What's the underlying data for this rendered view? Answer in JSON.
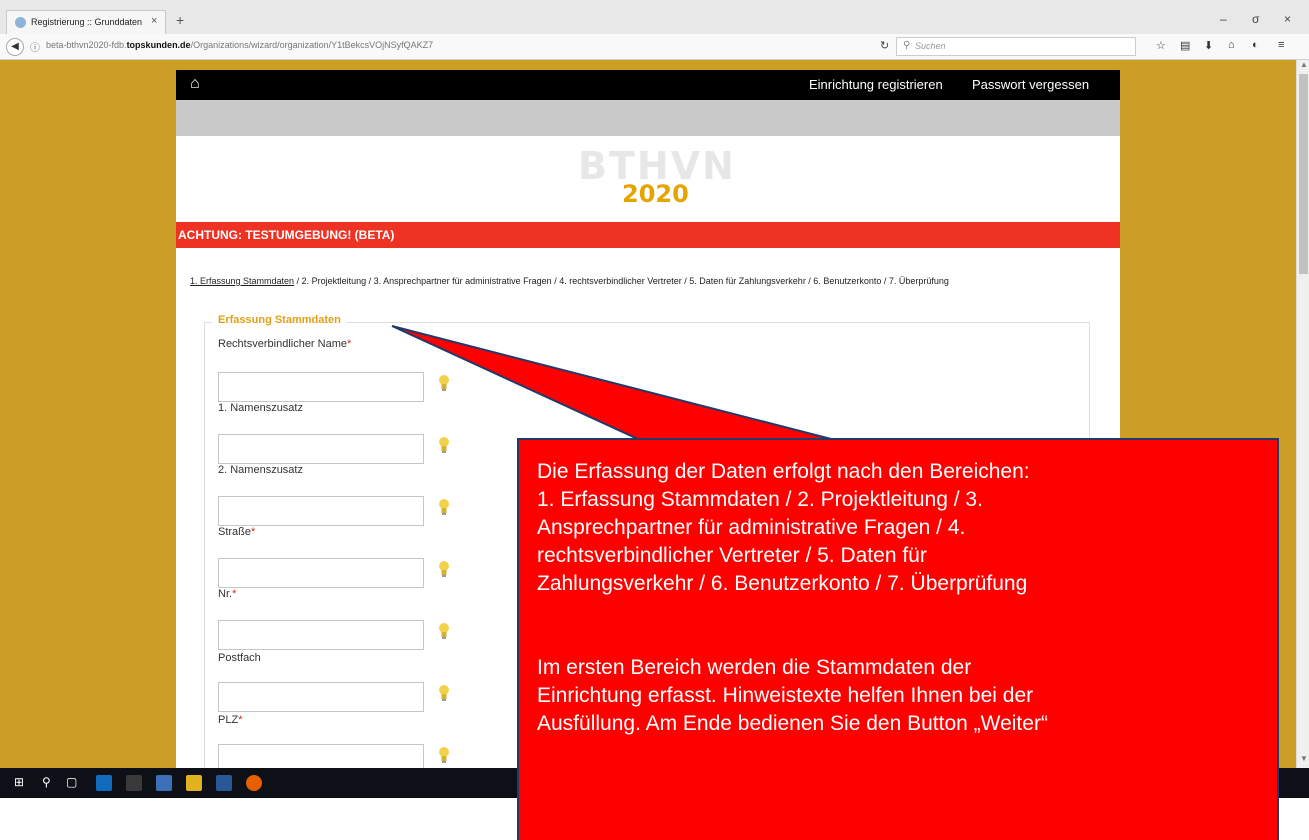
{
  "browser": {
    "tab_title": "Registrierung :: Grunddaten",
    "tab_close": "×",
    "new_tab": "+",
    "url_prefix": "beta-bthvn2020-fdb.",
    "url_domain": "topskunden.de",
    "url_path": "/Organizations/wizard/organization/Y1tBekcsVOjNSyfQAKZ7",
    "search_placeholder": "Suchen",
    "win_minimize": "–",
    "win_restore": "σ",
    "win_close": "×"
  },
  "nav": {
    "register": "Einrichtung registrieren",
    "password": "Passwort vergessen"
  },
  "logo": {
    "line1": "BTHVN",
    "line2": "2020"
  },
  "warning": "ACHTUNG: TESTUMGEBUNG! (BETA)",
  "steps": {
    "active": "1. Erfassung Stammdaten",
    "rest": " / 2. Projektleitung / 3. Ansprechpartner für administrative Fragen / 4. rechtsverbindlicher Vertreter / 5. Daten für Zahlungsverkehr / 6. Benutzerkonto / 7. Überprüfung"
  },
  "form": {
    "legend": "Erfassung Stammdaten",
    "fields": [
      {
        "label": "Rechtsverbindlicher Name",
        "required": "*"
      },
      {
        "label": "1. Namenszusatz",
        "required": ""
      },
      {
        "label": "2. Namenszusatz",
        "required": ""
      },
      {
        "label": "Straße",
        "required": "*"
      },
      {
        "label": "Nr.",
        "required": "*"
      },
      {
        "label": "Postfach",
        "required": ""
      },
      {
        "label": "PLZ",
        "required": "*"
      }
    ]
  },
  "callout": {
    "lines": [
      "Die Erfassung der Daten erfolgt nach den Bereichen:",
      "1. Erfassung Stammdaten / 2. Projektleitung / 3.",
      "Ansprechpartner für administrative Fragen / 4.",
      "rechtsverbindlicher Vertreter / 5. Daten für",
      "Zahlungsverkehr / 6. Benutzerkonto / 7. Überprüfung",
      "Im ersten Bereich werden die Stammdaten der",
      "Einrichtung erfasst. Hinweistexte helfen Ihnen bei der",
      "Ausfüllung. Am Ende bedienen Sie den Button „Weiter“"
    ]
  },
  "colors": {
    "page_bg": "#cc9e25",
    "warning_bar": "#ee3325",
    "legend": "#e0a01a",
    "callout": "#ff0000",
    "logo_year": "#e5a400"
  },
  "icons": {
    "home": "home-icon",
    "hint": "lightbulb-icon",
    "search": "search-icon"
  }
}
